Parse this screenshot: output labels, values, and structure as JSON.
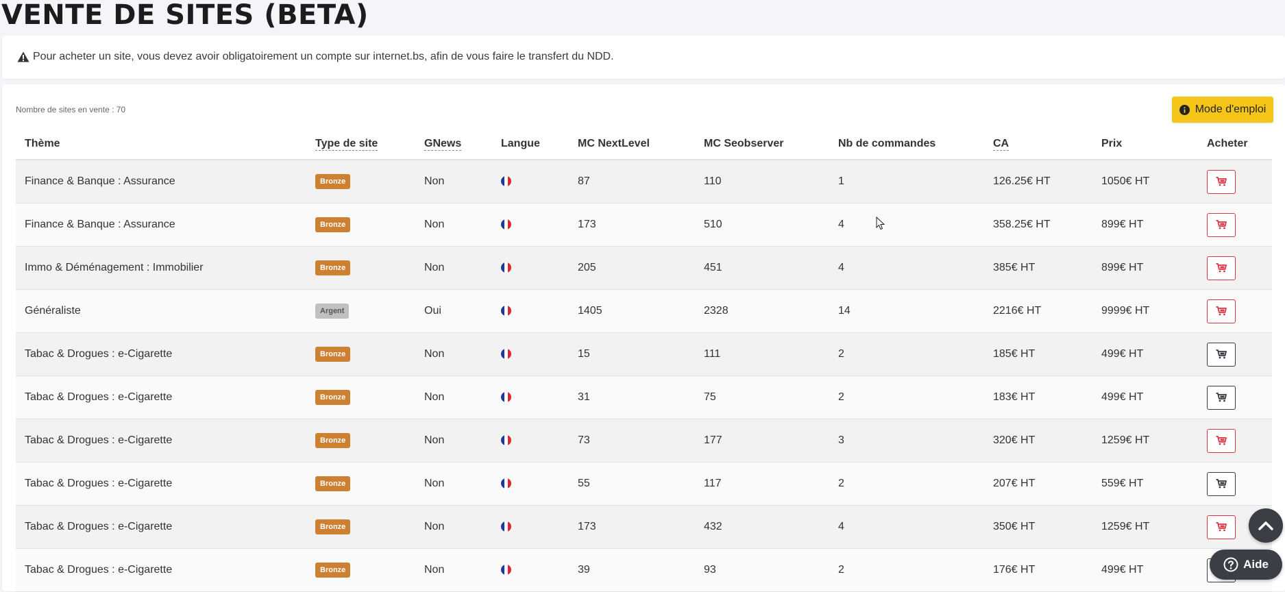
{
  "page": {
    "title": "VENTE DE SITES (BETA)"
  },
  "notice": {
    "icon": "warning-icon",
    "text": "Pour acheter un site, vous devez avoir obligatoirement un compte sur internet.bs, afin de vous faire le transfert du NDD."
  },
  "listing": {
    "count_label": "Nombre de sites en vente : 70",
    "mode_button_label": "Mode d'emploi",
    "columns": {
      "theme": "Thème",
      "type": "Type de site",
      "gnews": "GNews",
      "langue": "Langue",
      "mc_nextlevel": "MC NextLevel",
      "mc_seobserver": "MC Seobserver",
      "commandes": "Nb de commandes",
      "ca": "CA",
      "prix": "Prix",
      "acheter": "Acheter"
    },
    "rows": [
      {
        "theme": "Finance & Banque : Assurance",
        "type": "Bronze",
        "gnews": "Non",
        "langue": "fr",
        "mc_nextlevel": "87",
        "mc_seobserver": "110",
        "commandes": "1",
        "ca": "126.25€ HT",
        "prix": "1050€ HT",
        "buy_style": "red"
      },
      {
        "theme": "Finance & Banque : Assurance",
        "type": "Bronze",
        "gnews": "Non",
        "langue": "fr",
        "mc_nextlevel": "173",
        "mc_seobserver": "510",
        "commandes": "4",
        "ca": "358.25€ HT",
        "prix": "899€ HT",
        "buy_style": "red"
      },
      {
        "theme": "Immo & Déménagement : Immobilier",
        "type": "Bronze",
        "gnews": "Non",
        "langue": "fr",
        "mc_nextlevel": "205",
        "mc_seobserver": "451",
        "commandes": "4",
        "ca": "385€ HT",
        "prix": "899€ HT",
        "buy_style": "red"
      },
      {
        "theme": "Généraliste",
        "type": "Argent",
        "gnews": "Oui",
        "langue": "fr",
        "mc_nextlevel": "1405",
        "mc_seobserver": "2328",
        "commandes": "14",
        "ca": "2216€ HT",
        "prix": "9999€ HT",
        "buy_style": "red"
      },
      {
        "theme": "Tabac & Drogues : e-Cigarette",
        "type": "Bronze",
        "gnews": "Non",
        "langue": "fr",
        "mc_nextlevel": "15",
        "mc_seobserver": "111",
        "commandes": "2",
        "ca": "185€ HT",
        "prix": "499€ HT",
        "buy_style": "dark"
      },
      {
        "theme": "Tabac & Drogues : e-Cigarette",
        "type": "Bronze",
        "gnews": "Non",
        "langue": "fr",
        "mc_nextlevel": "31",
        "mc_seobserver": "75",
        "commandes": "2",
        "ca": "183€ HT",
        "prix": "499€ HT",
        "buy_style": "dark"
      },
      {
        "theme": "Tabac & Drogues : e-Cigarette",
        "type": "Bronze",
        "gnews": "Non",
        "langue": "fr",
        "mc_nextlevel": "73",
        "mc_seobserver": "177",
        "commandes": "3",
        "ca": "320€ HT",
        "prix": "1259€ HT",
        "buy_style": "red"
      },
      {
        "theme": "Tabac & Drogues : e-Cigarette",
        "type": "Bronze",
        "gnews": "Non",
        "langue": "fr",
        "mc_nextlevel": "55",
        "mc_seobserver": "117",
        "commandes": "2",
        "ca": "207€ HT",
        "prix": "559€ HT",
        "buy_style": "dark"
      },
      {
        "theme": "Tabac & Drogues : e-Cigarette",
        "type": "Bronze",
        "gnews": "Non",
        "langue": "fr",
        "mc_nextlevel": "173",
        "mc_seobserver": "432",
        "commandes": "4",
        "ca": "350€ HT",
        "prix": "1259€ HT",
        "buy_style": "red"
      },
      {
        "theme": "Tabac & Drogues : e-Cigarette",
        "type": "Bronze",
        "gnews": "Non",
        "langue": "fr",
        "mc_nextlevel": "39",
        "mc_seobserver": "93",
        "commandes": "2",
        "ca": "176€ HT",
        "prix": "499€ HT",
        "buy_style": "dark"
      }
    ]
  },
  "floating": {
    "help_label": "Aide",
    "scroll_icon": "chevron-up-icon"
  },
  "colors": {
    "accent_yellow": "#f5c518",
    "bronze": "#cd7f32",
    "argent": "#c0c0c0",
    "buy_red": "#dc3545",
    "buy_dark": "#343a40",
    "floating_bg": "#3b3f45"
  }
}
